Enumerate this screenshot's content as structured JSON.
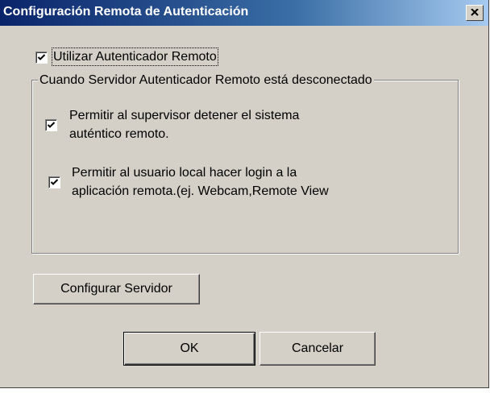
{
  "window": {
    "title": "Configuración Remota de Autenticación",
    "close_glyph": "✕"
  },
  "use_remote": {
    "label": "Utilizar Autenticador Remoto",
    "checked": true
  },
  "group": {
    "legend": "Cuando Servidor Autenticador Remoto está desconectado",
    "options": [
      {
        "line1": "Permitir al supervisor detener el sistema",
        "line2": "auténtico remoto.",
        "checked": true
      },
      {
        "line1": "Permitir al usuario local hacer login a la",
        "line2": "aplicación remota.(ej. Webcam,Remote View",
        "checked": true
      }
    ]
  },
  "buttons": {
    "configure": "Configurar Servidor",
    "ok": "OK",
    "cancel": "Cancelar"
  },
  "colors": {
    "title_bar_start": "#0a246a",
    "title_bar_end": "#a6caf0",
    "face": "#d4d0c8"
  }
}
